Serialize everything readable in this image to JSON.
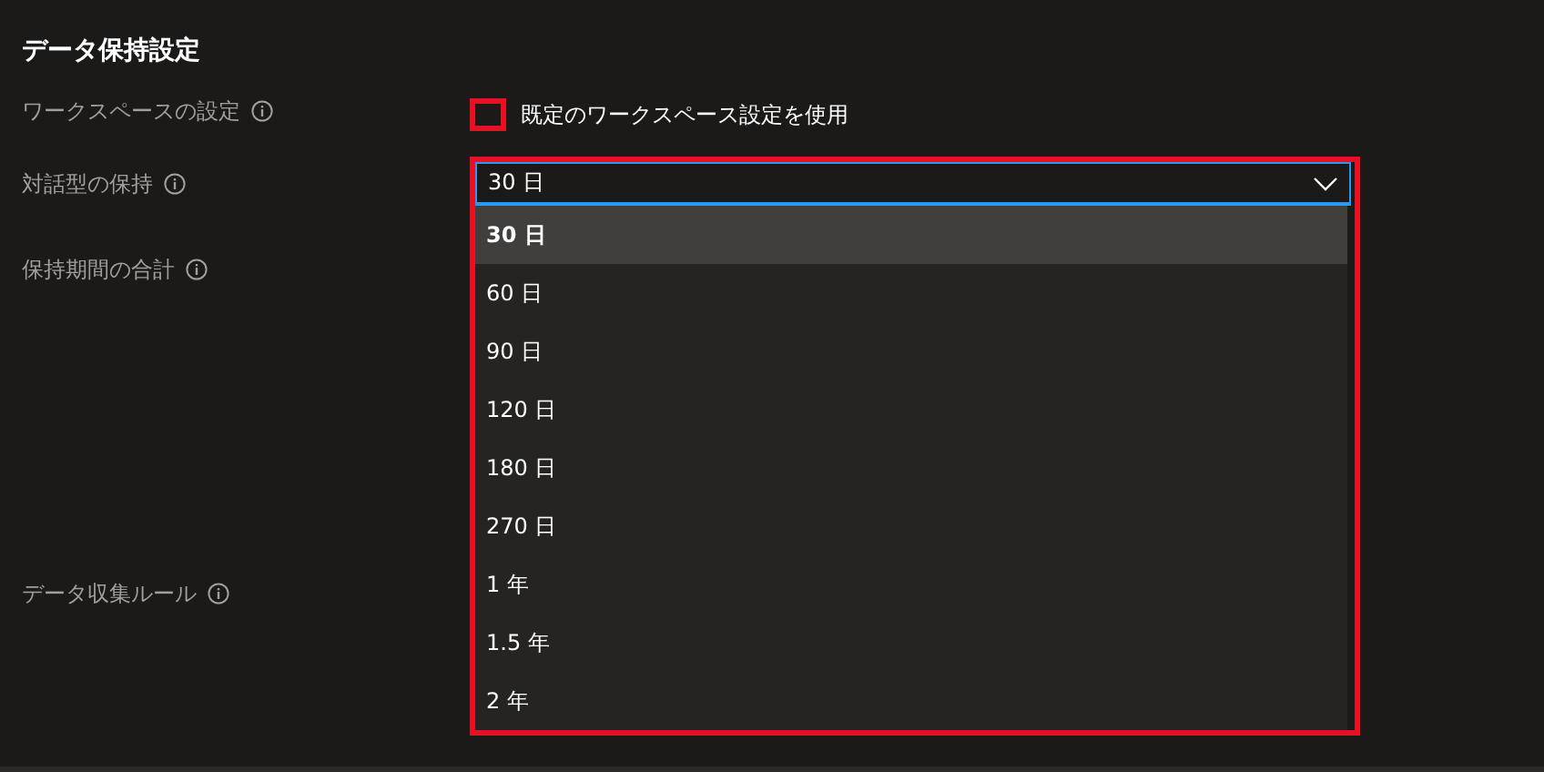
{
  "title": "データ保持設定",
  "labels": [
    "ワークスペースの設定",
    "対話型の保持",
    "保持期間の合計",
    "データ収集ルール"
  ],
  "workspace_checkbox": {
    "label": "既定のワークスペース設定を使用",
    "checked": false
  },
  "retention_dropdown": {
    "value": "30 日",
    "expanded": true,
    "options": [
      {
        "label": "30 日",
        "selected": true
      },
      {
        "label": "60 日",
        "selected": false
      },
      {
        "label": "90 日",
        "selected": false
      },
      {
        "label": "120 日",
        "selected": false
      },
      {
        "label": "180 日",
        "selected": false
      },
      {
        "label": "270 日",
        "selected": false
      },
      {
        "label": "1 年",
        "selected": false
      },
      {
        "label": "1.5 年",
        "selected": false
      },
      {
        "label": "2 年",
        "selected": false
      }
    ]
  }
}
